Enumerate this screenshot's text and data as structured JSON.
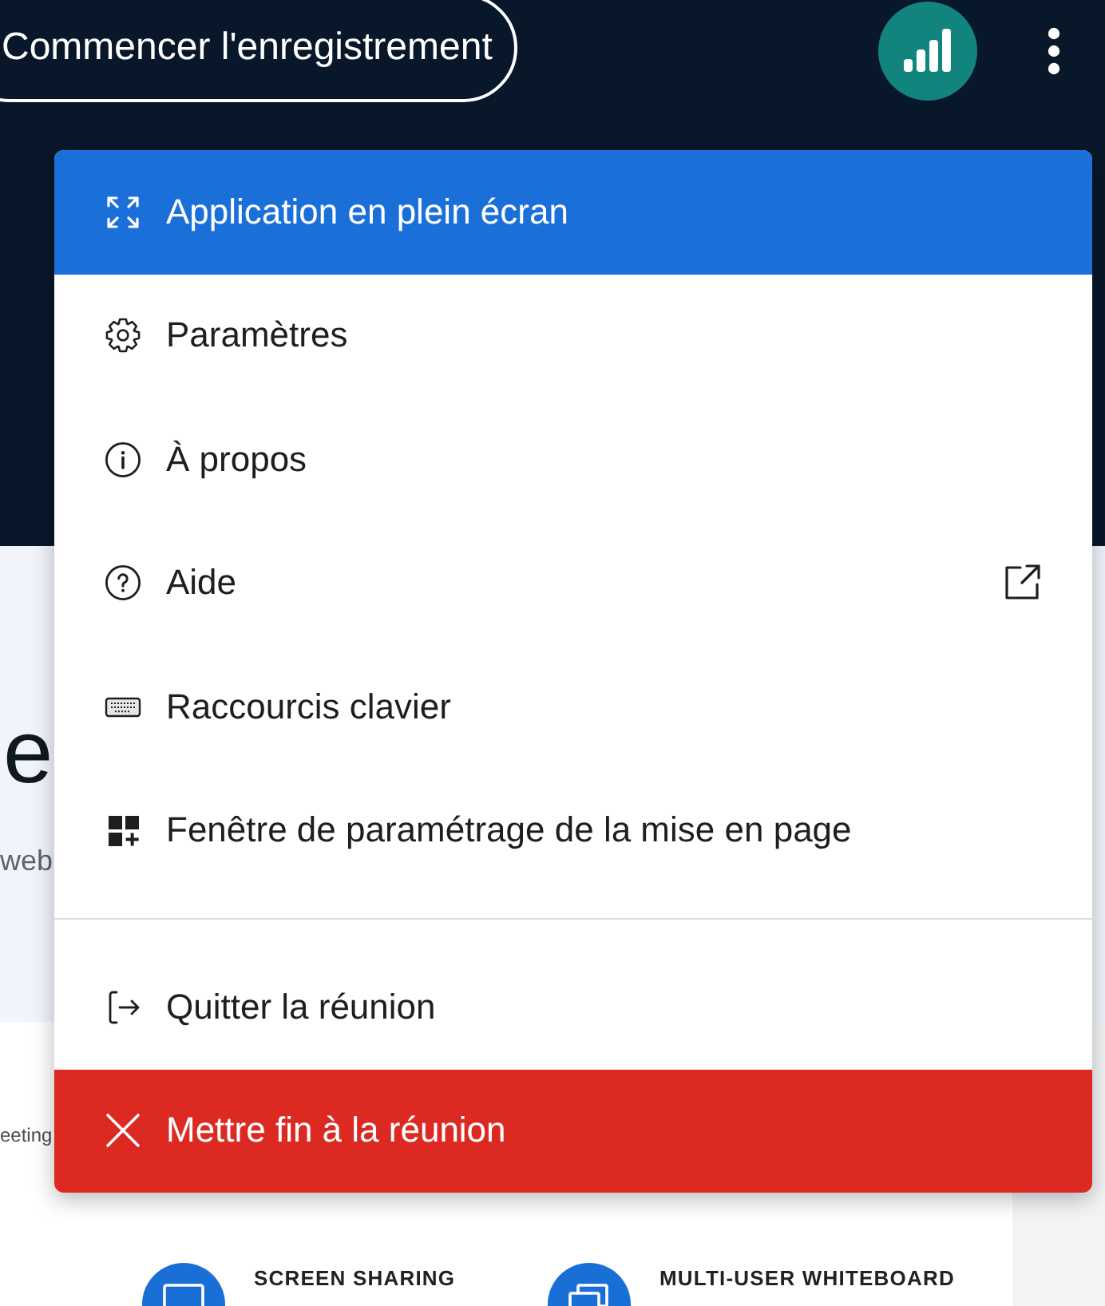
{
  "header": {
    "record_button": {
      "label": "Commencer l'enregistrement"
    }
  },
  "menu": {
    "sections": [
      {
        "items": [
          {
            "label": "Application en plein écran",
            "kind": "normal",
            "selected": true,
            "external": false
          },
          {
            "label": "Paramètres",
            "kind": "normal",
            "selected": false,
            "external": false
          },
          {
            "label": "À propos",
            "kind": "normal",
            "selected": false,
            "external": false
          },
          {
            "label": "Aide",
            "kind": "normal",
            "selected": false,
            "external": true
          },
          {
            "label": "Raccourcis clavier",
            "kind": "normal",
            "selected": false,
            "external": false
          },
          {
            "label": "Fenêtre de paramétrage de la mise en page",
            "kind": "normal",
            "selected": false,
            "external": false
          }
        ]
      },
      {
        "items": [
          {
            "label": "Quitter la réunion",
            "kind": "normal",
            "selected": false,
            "external": false
          },
          {
            "label": "Mettre fin à la réunion",
            "kind": "danger",
            "selected": false,
            "external": false
          }
        ]
      }
    ]
  },
  "background": {
    "heading": "e",
    "subtitle": "web",
    "caption": "eeting",
    "features": [
      {
        "title": "SCREEN SHARING"
      },
      {
        "title": "MULTI-USER WHITEBOARD"
      }
    ]
  }
}
